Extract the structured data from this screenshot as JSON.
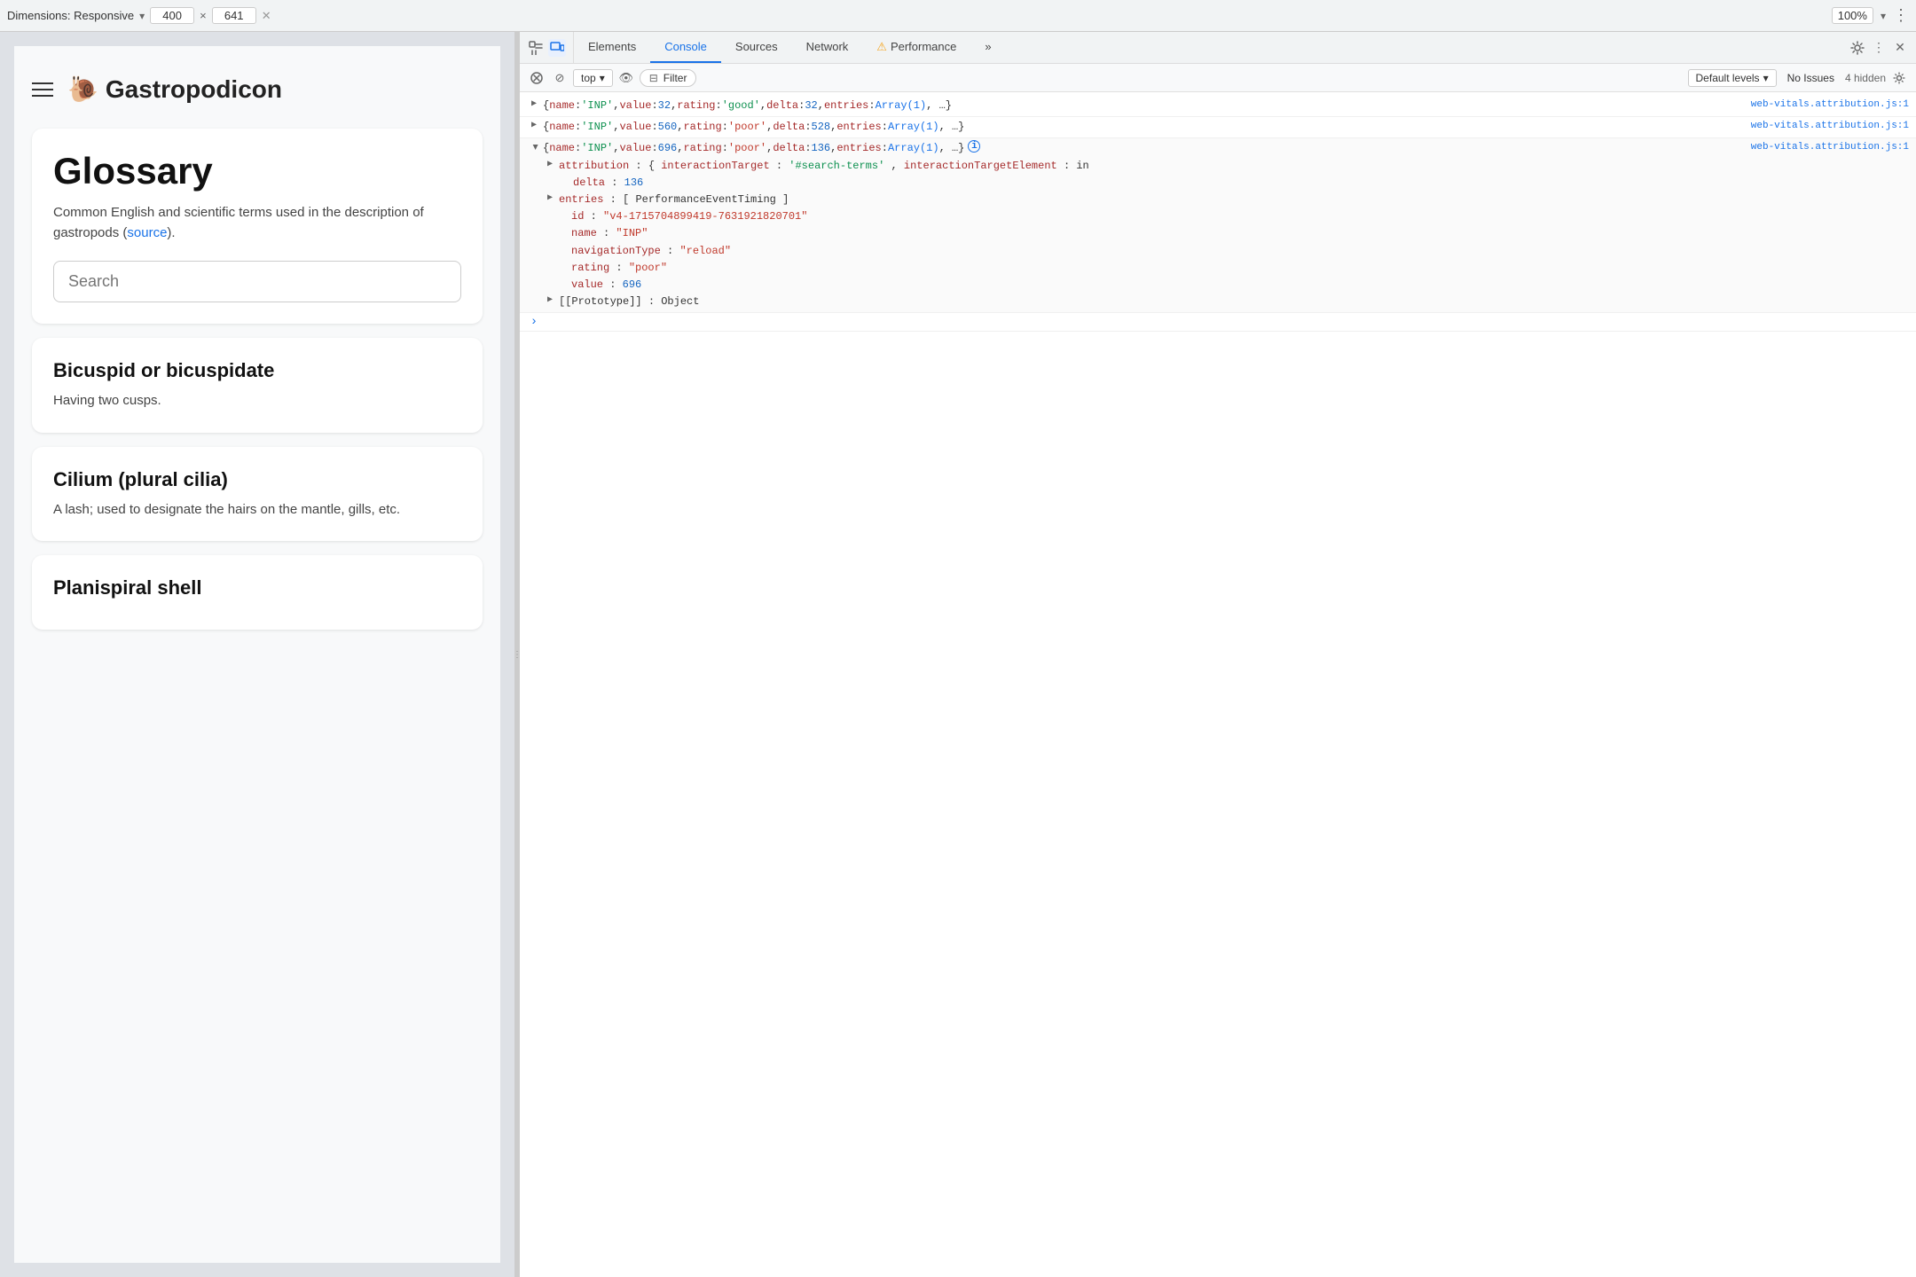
{
  "toolbar": {
    "dimensions_label": "Dimensions: Responsive",
    "width_value": "400",
    "x_sep": "×",
    "height_value": "641",
    "zoom_value": "100%"
  },
  "webpage": {
    "site_name": "Gastropodicon",
    "glossary_title": "Glossary",
    "glossary_desc_text": "Common English and scientific terms used in the description of gastropods (",
    "glossary_source_link": "source",
    "glossary_desc_end": ").",
    "search_placeholder": "Search",
    "terms": [
      {
        "title": "Bicuspid or bicuspidate",
        "desc": "Having two cusps."
      },
      {
        "title": "Cilium (plural cilia)",
        "desc": "A lash; used to designate the hairs on the mantle, gills, etc."
      },
      {
        "title": "Planispiral shell",
        "desc": ""
      }
    ]
  },
  "devtools": {
    "tabs": [
      {
        "label": "Elements",
        "active": false
      },
      {
        "label": "Console",
        "active": true
      },
      {
        "label": "Sources",
        "active": false
      },
      {
        "label": "Network",
        "active": false
      },
      {
        "label": "Performance",
        "active": false,
        "warning": true
      }
    ],
    "more_tabs": "»",
    "secondary": {
      "context_dropdown": "top",
      "filter_label": "Filter",
      "levels_label": "Default levels",
      "no_issues": "No Issues",
      "hidden_count": "4 hidden"
    },
    "console_entries": [
      {
        "id": "row1",
        "expanded": false,
        "source_file": "web-vitals.attribution.js:1",
        "content": "{name: 'INP', value: 32, rating: 'good', delta: 32, entries: Array(1), …}"
      },
      {
        "id": "row2",
        "expanded": false,
        "source_file": "web-vitals.attribution.js:1",
        "content": "{name: 'INP', value: 560, rating: 'poor', delta: 528, entries: Array(1), …}"
      },
      {
        "id": "row3",
        "expanded": true,
        "source_file": "web-vitals.attribution.js:1",
        "main_line": "{name: 'INP', value: 696, rating: 'poor', delta: 136, entries: Array(1), …}",
        "has_info": true,
        "children": [
          {
            "key": "attribution",
            "value": "{interactionTarget: '#search-terms', interactionTargetElement: in",
            "expandable": true
          },
          {
            "key": "delta",
            "value": "136",
            "expandable": false,
            "indent": 2
          },
          {
            "key": "entries",
            "value": "[PerformanceEventTiming]",
            "expandable": true
          },
          {
            "key": "id",
            "value": "\"v4-1715704899419-7631921820701\"",
            "expandable": false,
            "is_string": true
          },
          {
            "key": "name",
            "value": "\"INP\"",
            "expandable": false,
            "is_string": true
          },
          {
            "key": "navigationType",
            "value": "\"reload\"",
            "expandable": false,
            "is_string": true
          },
          {
            "key": "rating",
            "value": "\"poor\"",
            "expandable": false,
            "is_string": true
          },
          {
            "key": "value",
            "value": "696",
            "expandable": false
          },
          {
            "key": "[[Prototype]]",
            "value": "Object",
            "expandable": true
          }
        ]
      }
    ],
    "prompt_symbol": ">"
  }
}
